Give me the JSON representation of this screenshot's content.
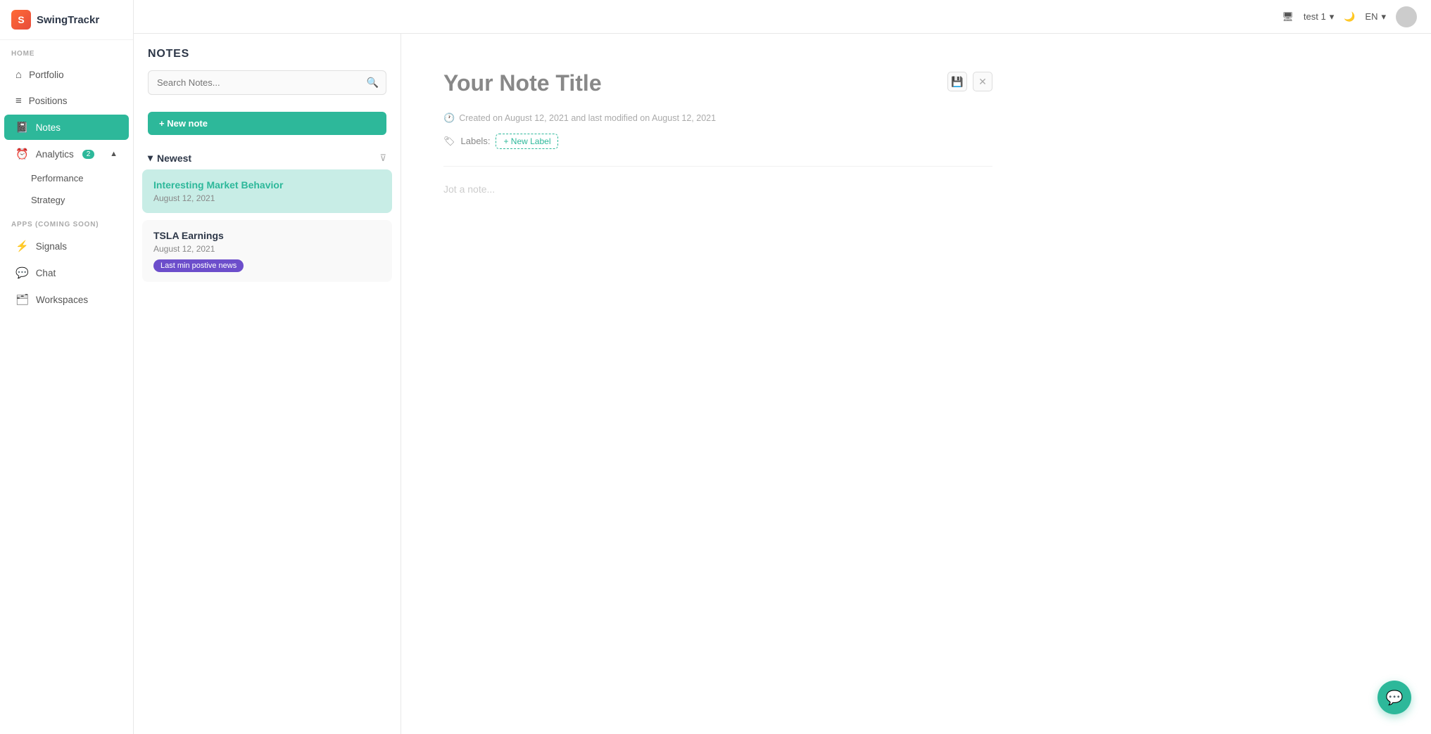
{
  "app": {
    "name": "SwingTrackr"
  },
  "topbar": {
    "user": "test 1",
    "language": "EN",
    "theme_icon": "🌙"
  },
  "sidebar": {
    "section_home": "HOME",
    "section_apps": "APPS (COMING SOON)",
    "items": [
      {
        "id": "portfolio",
        "label": "Portfolio",
        "icon": "⌂"
      },
      {
        "id": "positions",
        "label": "Positions",
        "icon": "≡"
      },
      {
        "id": "notes",
        "label": "Notes",
        "icon": "📓",
        "active": true
      },
      {
        "id": "analytics",
        "label": "Analytics",
        "icon": "⏰",
        "badge": "2"
      },
      {
        "id": "performance",
        "label": "Performance",
        "icon": ""
      },
      {
        "id": "strategy",
        "label": "Strategy",
        "icon": ""
      },
      {
        "id": "signals",
        "label": "Signals",
        "icon": "⚡"
      },
      {
        "id": "chat",
        "label": "Chat",
        "icon": "💬"
      },
      {
        "id": "workspaces",
        "label": "Workspaces",
        "icon": "🗂"
      }
    ]
  },
  "notes_panel": {
    "title": "NOTES",
    "search_placeholder": "Search Notes...",
    "new_note_label": "+ New note",
    "newest_label": "Newest",
    "filter_icon": "filter",
    "notes": [
      {
        "id": "note1",
        "title": "Interesting Market Behavior",
        "date": "August 12, 2021",
        "selected": true,
        "tag": null
      },
      {
        "id": "note2",
        "title": "TSLA Earnings",
        "date": "August 12, 2021",
        "selected": false,
        "tag": "Last min postive news"
      }
    ]
  },
  "editor": {
    "title_placeholder": "Your Note Title",
    "meta_text": "Created on August 12, 2021 and last modified on  August 12, 2021",
    "labels_label": "Labels:",
    "new_label_btn": "+ New Label",
    "content_placeholder": "Jot a note...",
    "save_icon": "💾",
    "close_icon": "✕"
  }
}
